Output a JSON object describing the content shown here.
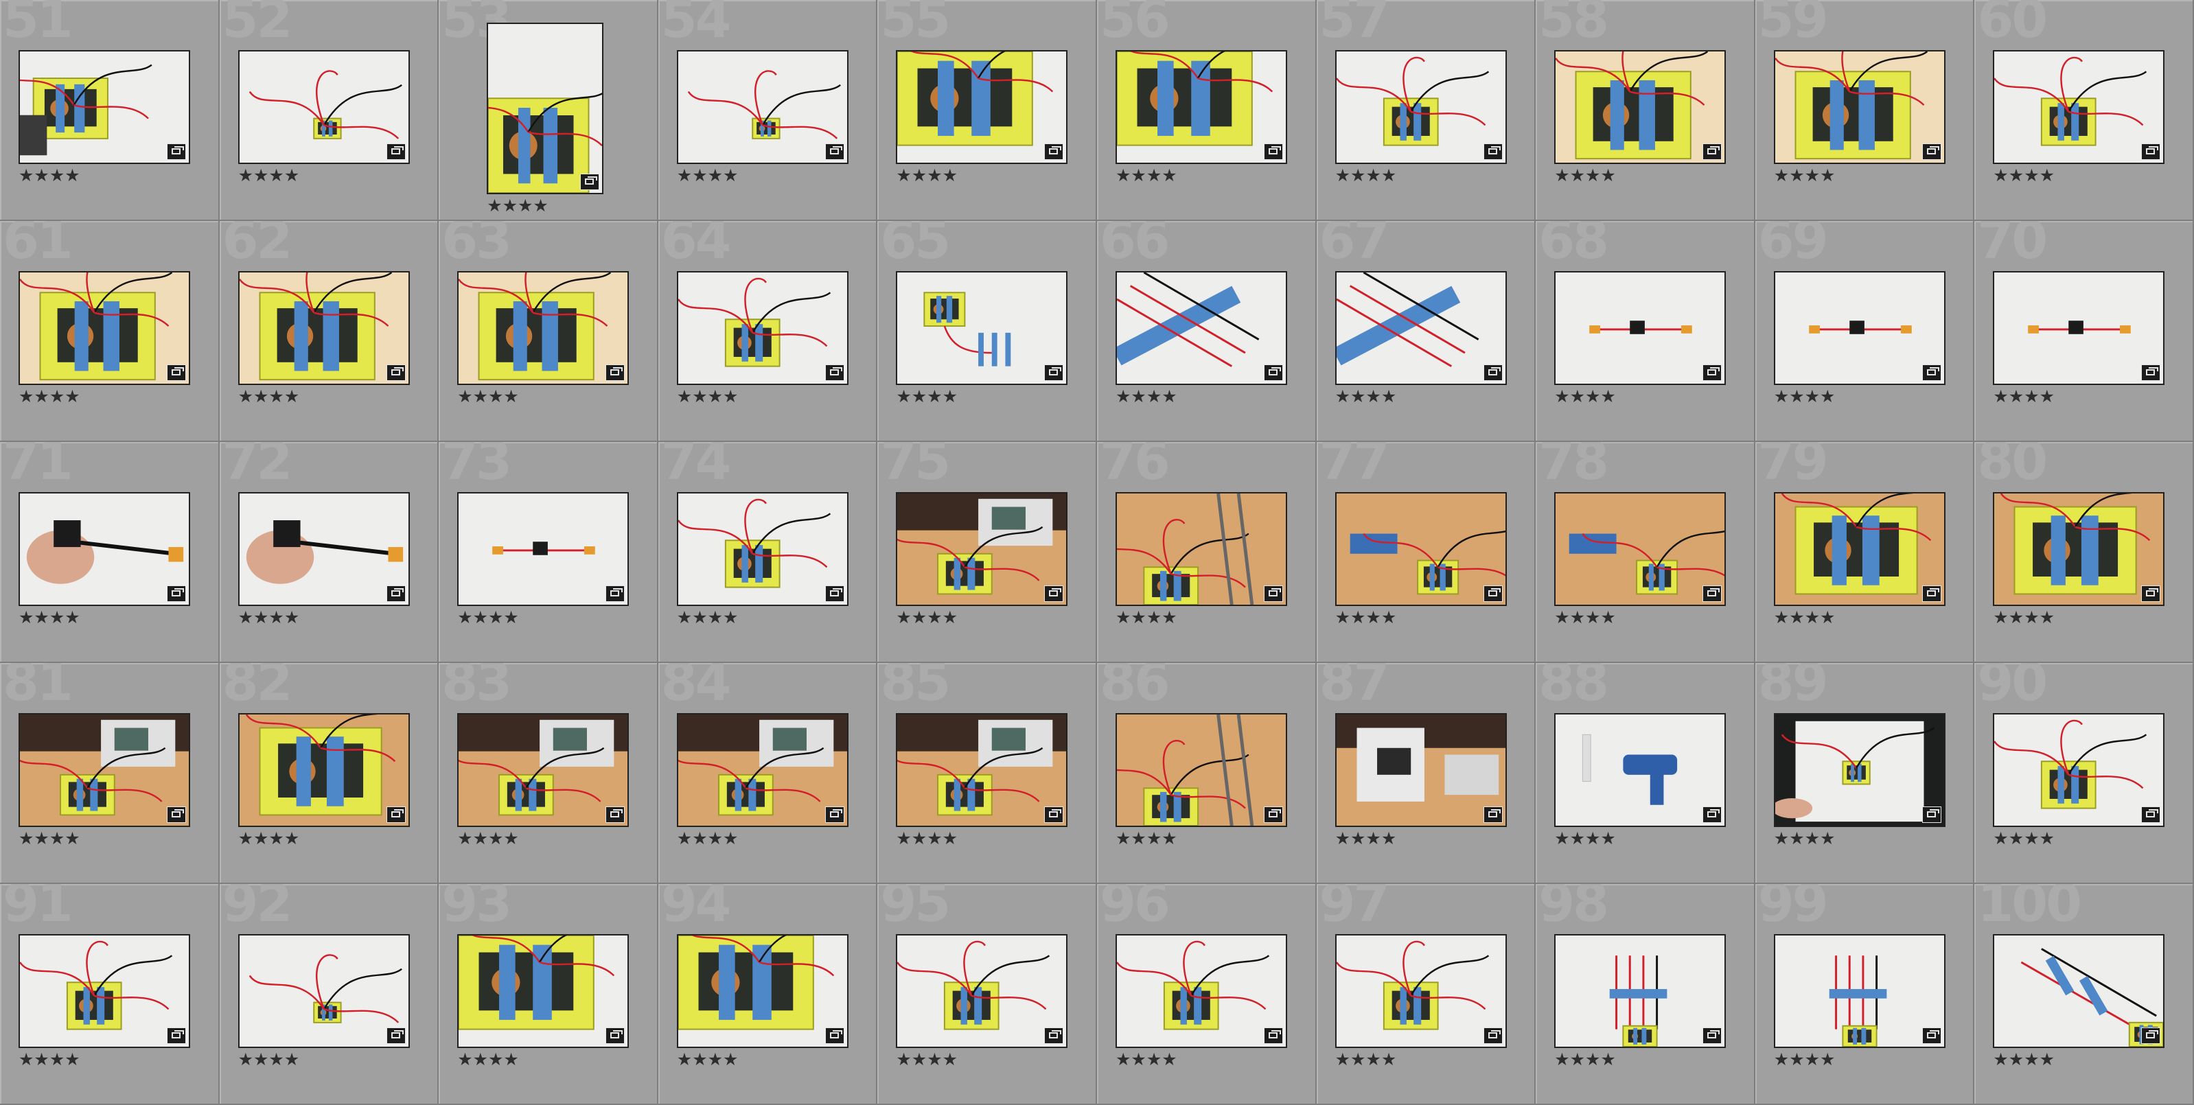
{
  "library": {
    "cells": [
      {
        "index": "51",
        "rating": "★★★★",
        "scene": "workbench-close"
      },
      {
        "index": "52",
        "rating": "★★★★",
        "scene": "wires-small"
      },
      {
        "index": "53",
        "rating": "★★★★",
        "scene": "portrait-box",
        "orientation": "portrait"
      },
      {
        "index": "54",
        "rating": "★★★★",
        "scene": "wires-small"
      },
      {
        "index": "55",
        "rating": "★★★★",
        "scene": "box-close"
      },
      {
        "index": "56",
        "rating": "★★★★",
        "scene": "box-close"
      },
      {
        "index": "57",
        "rating": "★★★★",
        "scene": "box-wires"
      },
      {
        "index": "58",
        "rating": "★★★★",
        "scene": "box-warm"
      },
      {
        "index": "59",
        "rating": "★★★★",
        "scene": "box-warm"
      },
      {
        "index": "60",
        "rating": "★★★★",
        "scene": "box-wires"
      },
      {
        "index": "61",
        "rating": "★★★★",
        "scene": "box-warm"
      },
      {
        "index": "62",
        "rating": "★★★★",
        "scene": "box-warm"
      },
      {
        "index": "63",
        "rating": "★★★★",
        "scene": "box-warm"
      },
      {
        "index": "64",
        "rating": "★★★★",
        "scene": "box-wires"
      },
      {
        "index": "65",
        "rating": "★★★★",
        "scene": "box-tape"
      },
      {
        "index": "66",
        "rating": "★★★★",
        "scene": "tape-terminals"
      },
      {
        "index": "67",
        "rating": "★★★★",
        "scene": "tape-terminals"
      },
      {
        "index": "68",
        "rating": "★★★★",
        "scene": "cable-small"
      },
      {
        "index": "69",
        "rating": "★★★★",
        "scene": "cable-small"
      },
      {
        "index": "70",
        "rating": "★★★★",
        "scene": "cable-small"
      },
      {
        "index": "71",
        "rating": "★★★★",
        "scene": "hand-cable"
      },
      {
        "index": "72",
        "rating": "★★★★",
        "scene": "hand-cable"
      },
      {
        "index": "73",
        "rating": "★★★★",
        "scene": "cable-small"
      },
      {
        "index": "74",
        "rating": "★★★★",
        "scene": "box-wires"
      },
      {
        "index": "75",
        "rating": "★★★★",
        "scene": "desk-meter"
      },
      {
        "index": "76",
        "rating": "★★★★",
        "scene": "desk-wood"
      },
      {
        "index": "77",
        "rating": "★★★★",
        "scene": "desk-battery"
      },
      {
        "index": "78",
        "rating": "★★★★",
        "scene": "desk-battery"
      },
      {
        "index": "79",
        "rating": "★★★★",
        "scene": "desk-box"
      },
      {
        "index": "80",
        "rating": "★★★★",
        "scene": "desk-box"
      },
      {
        "index": "81",
        "rating": "★★★★",
        "scene": "desk-meter"
      },
      {
        "index": "82",
        "rating": "★★★★",
        "scene": "desk-box"
      },
      {
        "index": "83",
        "rating": "★★★★",
        "scene": "desk-meter"
      },
      {
        "index": "84",
        "rating": "★★★★",
        "scene": "desk-meter"
      },
      {
        "index": "85",
        "rating": "★★★★",
        "scene": "desk-meter"
      },
      {
        "index": "86",
        "rating": "★★★★",
        "scene": "desk-wood"
      },
      {
        "index": "87",
        "rating": "★★★★",
        "scene": "desk-package"
      },
      {
        "index": "88",
        "rating": "★★★★",
        "scene": "glue-gun"
      },
      {
        "index": "89",
        "rating": "★★★★",
        "scene": "overhead-dark"
      },
      {
        "index": "90",
        "rating": "★★★★",
        "scene": "box-wires"
      },
      {
        "index": "91",
        "rating": "★★★★",
        "scene": "box-wires"
      },
      {
        "index": "92",
        "rating": "★★★★",
        "scene": "wires-small"
      },
      {
        "index": "93",
        "rating": "★★★★",
        "scene": "box-close"
      },
      {
        "index": "94",
        "rating": "★★★★",
        "scene": "box-close"
      },
      {
        "index": "95",
        "rating": "★★★★",
        "scene": "box-wires"
      },
      {
        "index": "96",
        "rating": "★★★★",
        "scene": "box-wires"
      },
      {
        "index": "97",
        "rating": "★★★★",
        "scene": "box-wires"
      },
      {
        "index": "98",
        "rating": "★★★★",
        "scene": "tape-vertical"
      },
      {
        "index": "99",
        "rating": "★★★★",
        "scene": "tape-vertical"
      },
      {
        "index": "100",
        "rating": "★★★★",
        "scene": "tape-diagonal"
      }
    ]
  },
  "colors": {
    "yellow": "#e4e84a",
    "blue": "#4f88c8",
    "red": "#d21f2a",
    "backdrop": "#eeeeec",
    "wood": "#d9a56e",
    "warm": "#f0dcb8"
  },
  "icons": {
    "badge": "stack-badge-icon",
    "rating": "star-rating"
  }
}
